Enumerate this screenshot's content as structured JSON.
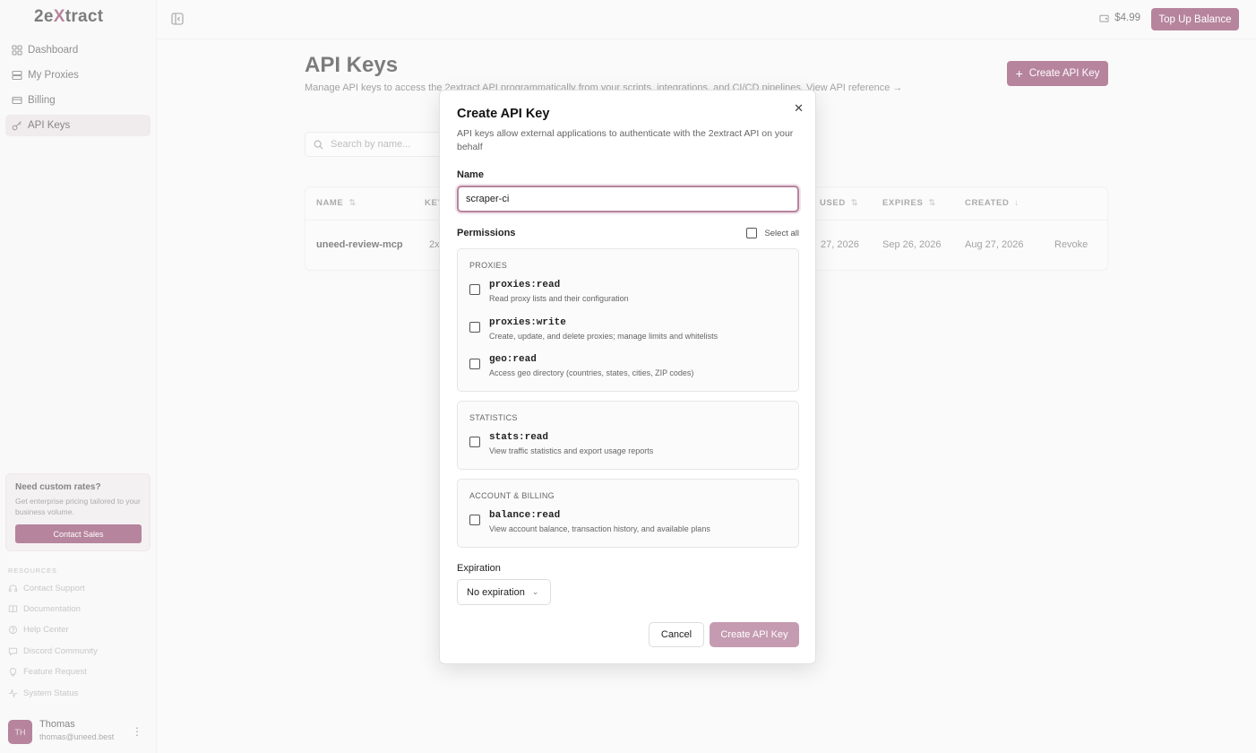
{
  "brand": {
    "logo_pre": "2e",
    "logo_x": "X",
    "logo_post": "tract",
    "accent": "#7a1f4e"
  },
  "sidebar": {
    "items": [
      {
        "label": "Dashboard",
        "icon": "grid-icon"
      },
      {
        "label": "My Proxies",
        "icon": "server-icon"
      },
      {
        "label": "Billing",
        "icon": "credit-card-icon"
      },
      {
        "label": "API Keys",
        "icon": "key-icon",
        "active": true
      }
    ],
    "promo": {
      "title": "Need custom rates?",
      "text": "Get enterprise pricing tailored to your business volume.",
      "button": "Contact Sales"
    },
    "resources_title": "RESOURCES",
    "resources": [
      {
        "label": "Contact Support",
        "icon": "headset-icon"
      },
      {
        "label": "Documentation",
        "icon": "book-icon"
      },
      {
        "label": "Help Center",
        "icon": "help-icon"
      },
      {
        "label": "Discord Community",
        "icon": "chat-icon"
      },
      {
        "label": "Feature Request",
        "icon": "lightbulb-icon"
      },
      {
        "label": "System Status",
        "icon": "activity-icon"
      }
    ],
    "user": {
      "initials": "TH",
      "name": "Thomas",
      "email": "thomas@uneed.best"
    }
  },
  "topbar": {
    "balance": "$4.99",
    "topup_label": "Top Up Balance"
  },
  "main": {
    "title": "API Keys",
    "description": "Manage API keys to access the 2extract API programmatically from your scripts, integrations, and CI/CD pipelines. View API reference →",
    "create_button": "Create API Key",
    "search_placeholder": "Search by name...",
    "table": {
      "columns": [
        "NAME",
        "KEY",
        "USED",
        "EXPIRES",
        "CREATED"
      ],
      "row": {
        "name": "uneed-review-mcp",
        "key": "2x",
        "used": "27, 2026",
        "expires": "Sep 26, 2026",
        "created": "Aug 27, 2026",
        "action": "Revoke"
      }
    }
  },
  "modal": {
    "title": "Create API Key",
    "description": "API keys allow external applications to authenticate with the 2extract API on your behalf",
    "name_label": "Name",
    "name_value": "scraper-ci",
    "permissions_label": "Permissions",
    "select_all": "Select all",
    "groups": [
      {
        "title": "PROXIES",
        "perms": [
          {
            "name": "proxies:read",
            "desc": "Read proxy lists and their configuration"
          },
          {
            "name": "proxies:write",
            "desc": "Create, update, and delete proxies; manage limits and whitelists"
          },
          {
            "name": "geo:read",
            "desc": "Access geo directory (countries, states, cities, ZIP codes)"
          }
        ]
      },
      {
        "title": "STATISTICS",
        "perms": [
          {
            "name": "stats:read",
            "desc": "View traffic statistics and export usage reports"
          }
        ]
      },
      {
        "title": "ACCOUNT & BILLING",
        "perms": [
          {
            "name": "balance:read",
            "desc": "View account balance, transaction history, and available plans"
          }
        ]
      }
    ],
    "expiration_label": "Expiration",
    "expiration_value": "No expiration",
    "cancel": "Cancel",
    "create": "Create API Key"
  }
}
